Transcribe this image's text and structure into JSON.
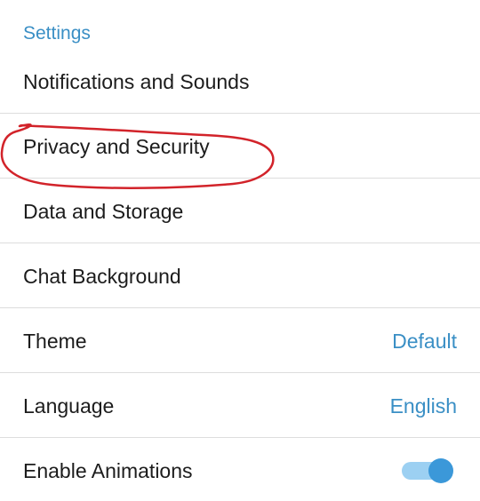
{
  "header": {
    "section_title": "Settings"
  },
  "settings": {
    "items": [
      {
        "label": "Notifications and Sounds"
      },
      {
        "label": "Privacy and Security"
      },
      {
        "label": "Data and Storage"
      },
      {
        "label": "Chat Background"
      },
      {
        "label": "Theme",
        "value": "Default"
      },
      {
        "label": "Language",
        "value": "English"
      },
      {
        "label": "Enable Animations",
        "toggle": true
      }
    ]
  },
  "colors": {
    "accent": "#3a8fc5",
    "annotation": "#d2232a",
    "toggle_track": "#9cd0f2",
    "toggle_knob": "#3b98d9"
  }
}
